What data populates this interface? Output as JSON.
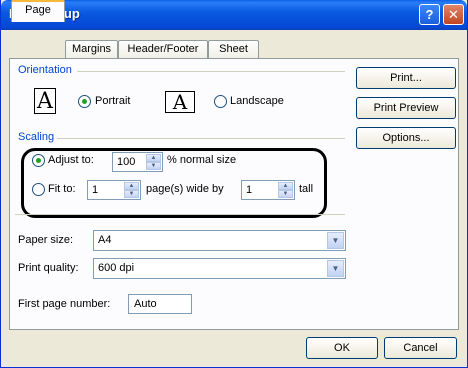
{
  "window": {
    "title": "Page Setup",
    "help_glyph": "?",
    "close_glyph": "✕"
  },
  "tabs": [
    {
      "label": "Page",
      "active": true
    },
    {
      "label": "Margins",
      "active": false
    },
    {
      "label": "Header/Footer",
      "active": false
    },
    {
      "label": "Sheet",
      "active": false
    }
  ],
  "orientation": {
    "group_label": "Orientation",
    "icon_glyph": "A",
    "portrait_label": "Portrait",
    "portrait_selected": true,
    "landscape_label": "Landscape",
    "landscape_selected": false
  },
  "scaling": {
    "group_label": "Scaling",
    "adjust_to_label": "Adjust to:",
    "adjust_to_value": "100",
    "adjust_to_selected": true,
    "normal_size_label": "% normal size",
    "fit_to_label": "Fit to:",
    "fit_to_selected": false,
    "fit_wide_value": "1",
    "pages_wide_label": "page(s) wide by",
    "fit_tall_value": "1",
    "tall_label": "tall"
  },
  "paper": {
    "paper_size_label": "Paper size:",
    "paper_size_value": "A4",
    "print_quality_label": "Print quality:",
    "print_quality_value": "600 dpi",
    "first_page_label": "First page number:",
    "first_page_value": "Auto"
  },
  "side_buttons": {
    "print": "Print...",
    "print_preview": "Print Preview",
    "options": "Options..."
  },
  "footer": {
    "ok": "OK",
    "cancel": "Cancel"
  },
  "colors": {
    "group_label": "#0046d5",
    "titlebar": "#0a5ae0",
    "dialog_bg": "#ece9d8"
  }
}
